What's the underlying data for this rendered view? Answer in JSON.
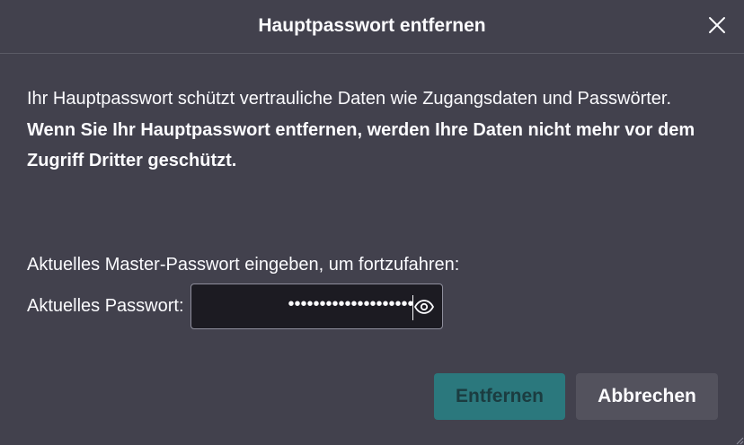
{
  "dialog": {
    "title": "Hauptpasswort entfernen",
    "description": "Ihr Hauptpasswort schützt vertrauliche Daten wie Zugangsdaten und Passwörter.",
    "warning": "Wenn Sie Ihr Hauptpasswort entfernen, werden Ihre Daten nicht mehr vor dem Zugriff Dritter geschützt.",
    "prompt": "Aktuelles Master-Passwort eingeben, um fortzufahren:",
    "password_label": "Aktuelles Passwort:",
    "password_value": "••••••••••••••••••••",
    "remove_button": "Entfernen",
    "cancel_button": "Abbrechen"
  },
  "icons": {
    "close": "close-icon",
    "reveal": "eye-icon"
  },
  "colors": {
    "background": "#42414d",
    "accent": "#2b787d",
    "field_background": "#1c1b22",
    "text": "#fbfbfe"
  }
}
